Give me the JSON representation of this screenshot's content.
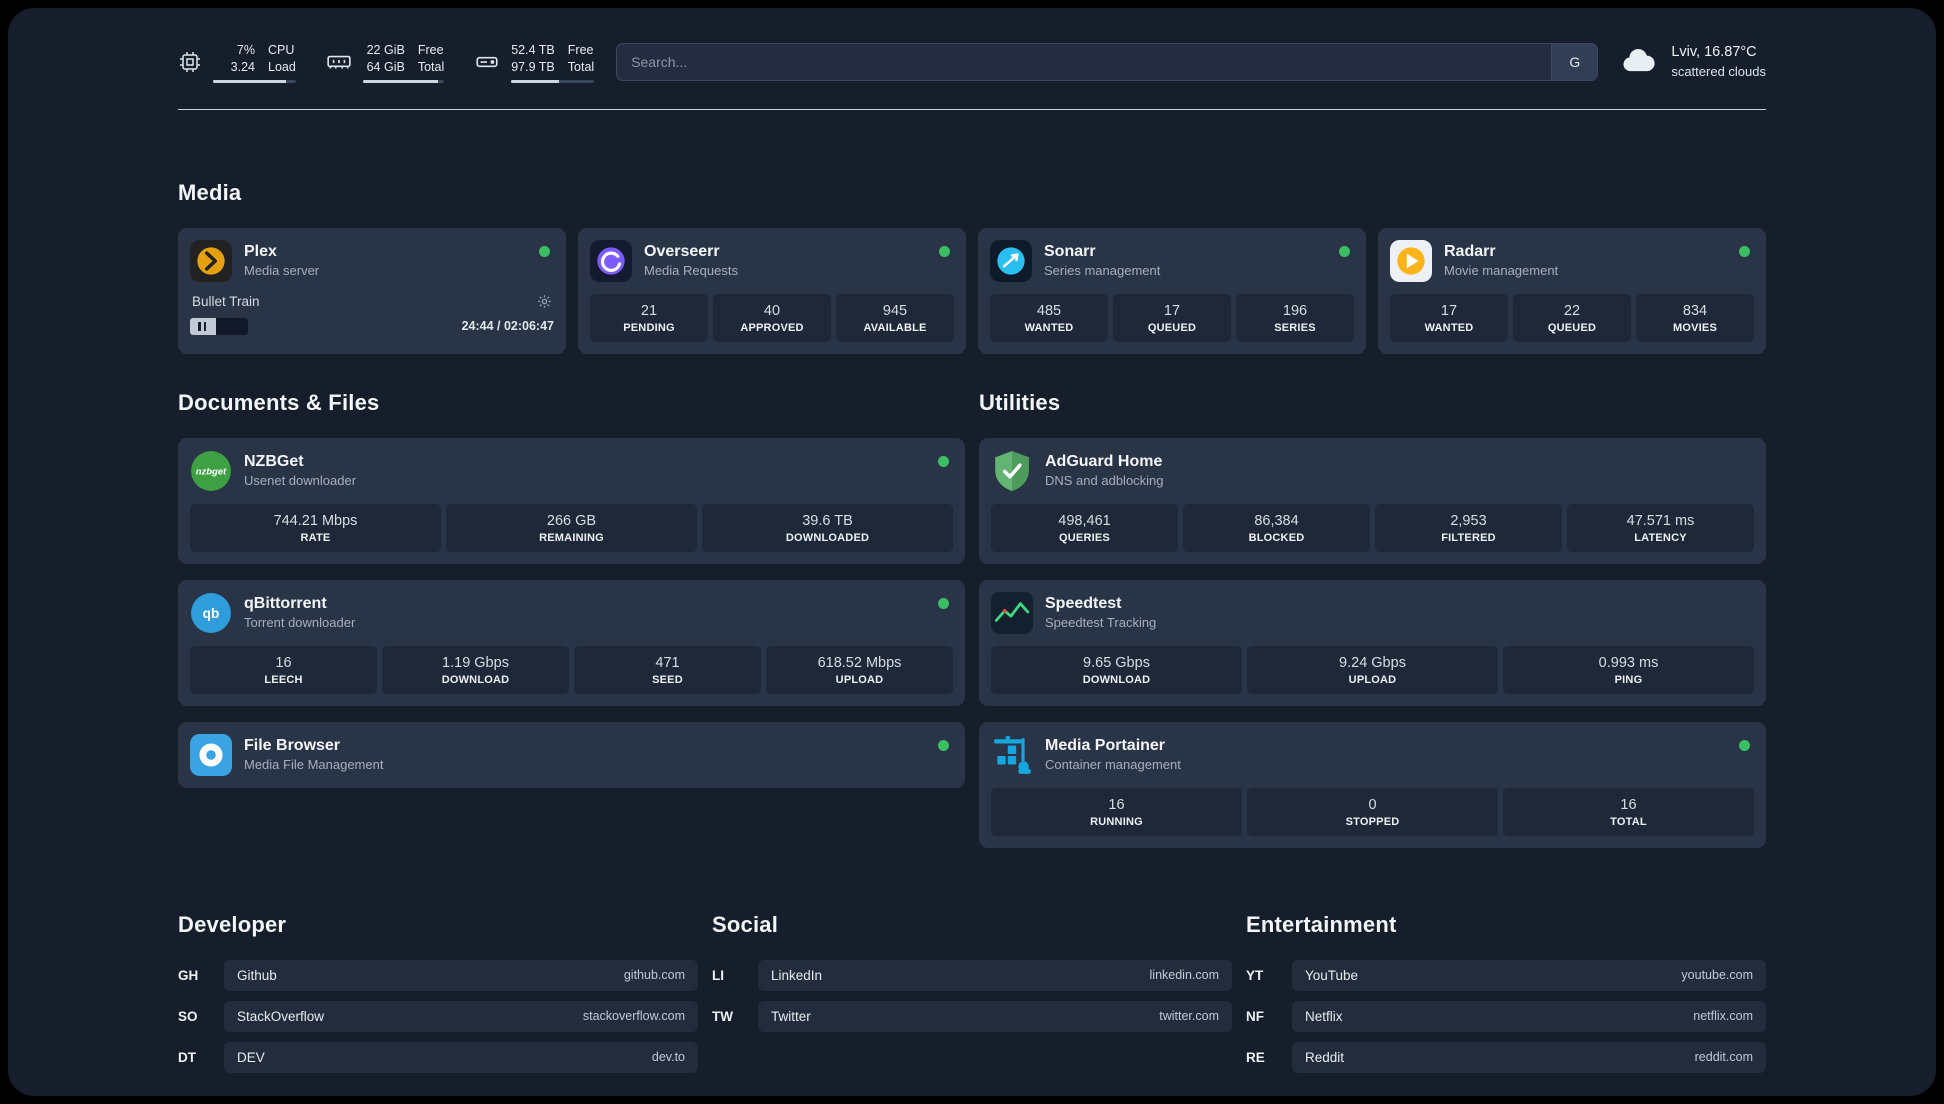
{
  "header": {
    "cpu": {
      "value_top": "7%",
      "value_bottom": "3.24",
      "label_top": "CPU",
      "label_bottom": "Load"
    },
    "ram": {
      "value_top": "22 GiB",
      "value_bottom": "64 GiB",
      "label_top": "Free",
      "label_bottom": "Total"
    },
    "disk": {
      "value_top": "52.4 TB",
      "value_bottom": "97.9 TB",
      "label_top": "Free",
      "label_bottom": "Total"
    },
    "search": {
      "placeholder": "Search...",
      "engine": "G"
    },
    "weather": {
      "location": "Lviv, 16.87°C",
      "condition": "scattered clouds"
    }
  },
  "icons": {
    "nzbget_text": "nzbget",
    "qbittorrent_text": "qb"
  },
  "colors": {
    "background": "#161e2c",
    "card": "#293446",
    "tile": "#1e2838",
    "online_dot": "#3cbf63"
  },
  "sections": {
    "media": {
      "title": "Media",
      "apps": [
        {
          "name": "Plex",
          "subtitle": "Media server",
          "player": {
            "track": "Bullet Train",
            "time": "24:44 / 02:06:47"
          }
        },
        {
          "name": "Overseerr",
          "subtitle": "Media Requests",
          "stats": [
            {
              "value": "21",
              "label": "PENDING"
            },
            {
              "value": "40",
              "label": "APPROVED"
            },
            {
              "value": "945",
              "label": "AVAILABLE"
            }
          ]
        },
        {
          "name": "Sonarr",
          "subtitle": "Series management",
          "stats": [
            {
              "value": "485",
              "label": "WANTED"
            },
            {
              "value": "17",
              "label": "QUEUED"
            },
            {
              "value": "196",
              "label": "SERIES"
            }
          ]
        },
        {
          "name": "Radarr",
          "subtitle": "Movie management",
          "stats": [
            {
              "value": "17",
              "label": "WANTED"
            },
            {
              "value": "22",
              "label": "QUEUED"
            },
            {
              "value": "834",
              "label": "MOVIES"
            }
          ]
        }
      ]
    },
    "documents": {
      "title": "Documents & Files",
      "apps": [
        {
          "name": "NZBGet",
          "subtitle": "Usenet downloader",
          "stats": [
            {
              "value": "744.21 Mbps",
              "label": "RATE"
            },
            {
              "value": "266 GB",
              "label": "REMAINING"
            },
            {
              "value": "39.6 TB",
              "label": "DOWNLOADED"
            }
          ]
        },
        {
          "name": "qBittorrent",
          "subtitle": "Torrent downloader",
          "stats": [
            {
              "value": "16",
              "label": "LEECH"
            },
            {
              "value": "1.19 Gbps",
              "label": "DOWNLOAD"
            },
            {
              "value": "471",
              "label": "SEED"
            },
            {
              "value": "618.52 Mbps",
              "label": "UPLOAD"
            }
          ]
        },
        {
          "name": "File Browser",
          "subtitle": "Media File Management"
        }
      ]
    },
    "utilities": {
      "title": "Utilities",
      "apps": [
        {
          "name": "AdGuard Home",
          "subtitle": "DNS and adblocking",
          "stats": [
            {
              "value": "498,461",
              "label": "QUERIES"
            },
            {
              "value": "86,384",
              "label": "BLOCKED"
            },
            {
              "value": "2,953",
              "label": "FILTERED"
            },
            {
              "value": "47.571 ms",
              "label": "LATENCY"
            }
          ]
        },
        {
          "name": "Speedtest",
          "subtitle": "Speedtest Tracking",
          "stats": [
            {
              "value": "9.65 Gbps",
              "label": "DOWNLOAD"
            },
            {
              "value": "9.24 Gbps",
              "label": "UPLOAD"
            },
            {
              "value": "0.993 ms",
              "label": "PING"
            }
          ]
        },
        {
          "name": "Media Portainer",
          "subtitle": "Container management",
          "stats": [
            {
              "value": "16",
              "label": "RUNNING"
            },
            {
              "value": "0",
              "label": "STOPPED"
            },
            {
              "value": "16",
              "label": "TOTAL"
            }
          ]
        }
      ]
    },
    "bookmarks": [
      {
        "title": "Developer",
        "items": [
          {
            "abbr": "GH",
            "name": "Github",
            "url": "github.com"
          },
          {
            "abbr": "SO",
            "name": "StackOverflow",
            "url": "stackoverflow.com"
          },
          {
            "abbr": "DT",
            "name": "DEV",
            "url": "dev.to"
          }
        ]
      },
      {
        "title": "Social",
        "items": [
          {
            "abbr": "LI",
            "name": "LinkedIn",
            "url": "linkedin.com"
          },
          {
            "abbr": "TW",
            "name": "Twitter",
            "url": "twitter.com"
          }
        ]
      },
      {
        "title": "Entertainment",
        "items": [
          {
            "abbr": "YT",
            "name": "YouTube",
            "url": "youtube.com"
          },
          {
            "abbr": "NF",
            "name": "Netflix",
            "url": "netflix.com"
          },
          {
            "abbr": "RE",
            "name": "Reddit",
            "url": "reddit.com"
          }
        ]
      }
    ]
  }
}
